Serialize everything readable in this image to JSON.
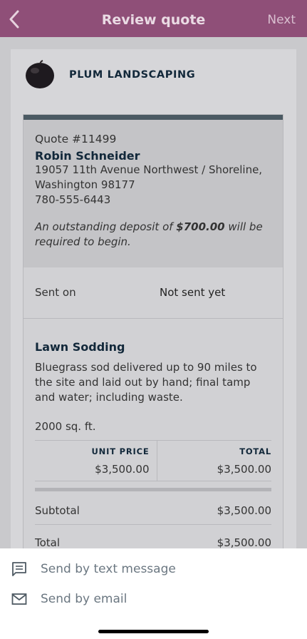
{
  "header": {
    "title": "Review quote",
    "next_label": "Next"
  },
  "company": {
    "name": "PLUM LANDSCAPING"
  },
  "quote": {
    "number": "Quote #11499",
    "client_name": "Robin Schneider",
    "address_line1": "19057 11th Avenue Northwest / Shoreline,",
    "address_line2": "Washington 98177",
    "phone": "780-555-6443",
    "deposit_before": "An outstanding deposit of ",
    "deposit_amount": "$700.00",
    "deposit_after": " will be required to begin."
  },
  "sent": {
    "label": "Sent on",
    "value": "Not sent yet"
  },
  "line_item": {
    "title": "Lawn Sodding",
    "description": "Bluegrass sod delivered up to 90 miles to the site and laid out by hand; final tamp and water; including waste.",
    "quantity": "2000 sq. ft.",
    "unit_price_header": "UNIT PRICE",
    "total_header": "TOTAL",
    "unit_price": "$3,500.00",
    "total": "$3,500.00"
  },
  "summary": {
    "subtotal_label": "Subtotal",
    "subtotal_value": "$3,500.00",
    "total_label": "Total",
    "total_value": "$3,500.00"
  },
  "sheet": {
    "text_option": "Send by text message",
    "email_option": "Send by email"
  },
  "colors": {
    "header_bg": "#8f4f78",
    "navy_text": "#12283a",
    "sheet_text": "#6b7781"
  }
}
